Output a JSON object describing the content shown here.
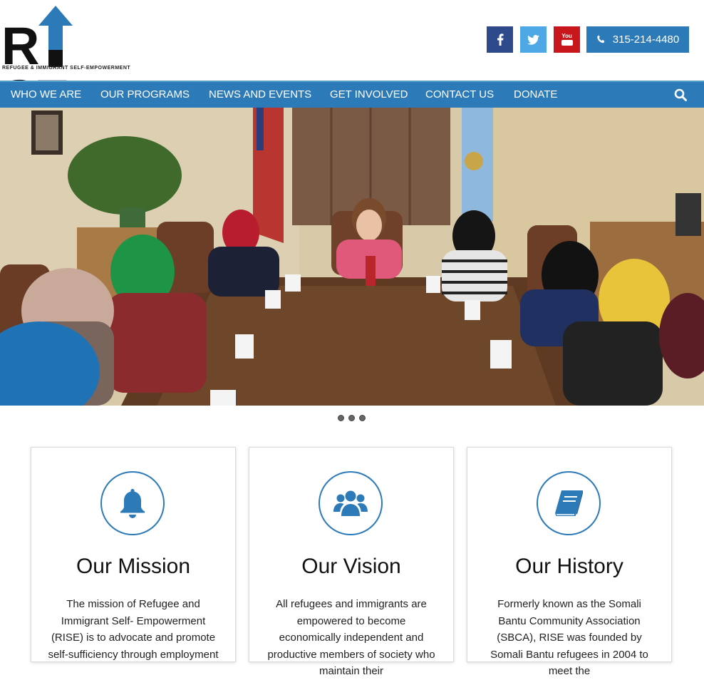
{
  "logo": {
    "word_left": "R",
    "word_right": "SE",
    "tagline": "REFUGEE & IMMIGRANT SELF-EMPOWERMENT"
  },
  "social": {
    "facebook_icon": "facebook-icon",
    "twitter_icon": "twitter-icon",
    "youtube_icon": "youtube-icon",
    "youtube_text": "You"
  },
  "phone": {
    "icon": "phone-icon",
    "number": "315-214-4480"
  },
  "nav": {
    "items": [
      "WHO WE ARE",
      "OUR PROGRAMS",
      "NEWS AND EVENTS",
      "GET INVOLVED",
      "CONTACT US",
      "DONATE"
    ],
    "search_icon": "search-icon"
  },
  "hero": {
    "slides_count": 3,
    "active_slide": 3
  },
  "cards": [
    {
      "icon": "bell-icon",
      "title": "Our Mission",
      "text": "The mission of Refugee and Immigrant Self- Empowerment (RISE) is to advocate and promote self-sufficiency through employment"
    },
    {
      "icon": "users-icon",
      "title": "Our Vision",
      "text": "All refugees and immigrants are empowered to become economically independent and productive members of society who maintain their"
    },
    {
      "icon": "book-icon",
      "title": "Our History",
      "text": "Formerly known as the Somali Bantu Community Association (SBCA), RISE was founded by Somali Bantu refugees in 2004 to meet the"
    }
  ],
  "colors": {
    "brand_blue": "#2d7ab8",
    "facebook": "#2f4a8a",
    "twitter": "#4fa8e6",
    "youtube": "#c8161d"
  }
}
